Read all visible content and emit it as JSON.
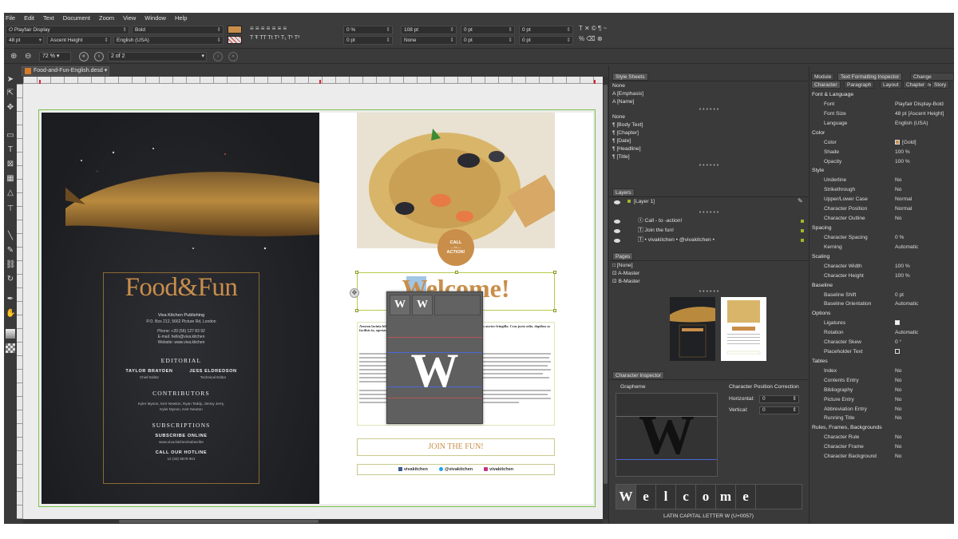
{
  "menu": [
    "File",
    "Edit",
    "Text",
    "Document",
    "Zoom",
    "View",
    "Window",
    "Help"
  ],
  "toolbar": {
    "font_family": "Playfair Display",
    "font_style": "Bold",
    "font_size": "48 pt",
    "ascent": "Ascent Height",
    "language": "English (USA)",
    "tracking": "0 %",
    "leading": "108 pt",
    "indent1": "0 pt",
    "indent2": "0 pt",
    "indent3": "0 pt",
    "indent4": "0 pt",
    "none": "None",
    "indent5": "0 pt",
    "indent6": "0 pt",
    "text_styles": "T Ŧ TT Tt T¹ T₁ T¹ T²",
    "align": "≡ ≡ ≡ ≡ ≡ ≡ ≡",
    "extra": "T ✕   © ¶ ~"
  },
  "nav": {
    "zoom": "72 %",
    "page": "2 of 2"
  },
  "document_tab": "Food-and-Fun-English.desd",
  "left_page": {
    "title": "Food&Fun",
    "publisher": "Viva Kitchen Publishing",
    "address": "P.O. Box 212, 5662 Picture Rd, London",
    "phone": "Phone: +20 (56) 127 83 92",
    "email": "E-mail: hello@viva.kitchen",
    "website": "Website: www.viva.kitchen",
    "editorial": "EDITORIAL",
    "editor1": "TAYLOR BRAYDEN",
    "editor1_role": "Chief Editor",
    "editor2": "JESS ELDREDSON",
    "editor2_role": "Technical Editor",
    "contributors": "CONTRIBUTORS",
    "contributors_list": "Kyler Mynon, Kerr Newton, Ryan Teddy, Jimmy Jerry,",
    "contributors_list2": "Kyler Mynon, Kerr Newton",
    "subscriptions": "SUBSCRIPTIONS",
    "subscribe_online": "SUBSCRIBE ONLINE",
    "subscribe_url": "www.viva.kitchen/subscribe",
    "hotline": "CALL OUR HOTLINE",
    "hotline_number": "12 (34) 5678 901"
  },
  "right_page": {
    "cta": "CALL",
    "cta2": "— to —",
    "cta3": "ACTION!",
    "welcome": "Welcome!",
    "body_heading": "Aenean lacinia bibendum nulla sed consectetur. Donec ullamcorper nulla non metus auctor fringilla. Cras justo odio, dapibus ac facilisis in, egestas eget quam.",
    "join": "JOIN THE FUN!",
    "social1": "vivakitchen",
    "social2": "@vivakitchen",
    "social3": "vivakitchen"
  },
  "glyph_popup": {
    "cell1": "W",
    "cell2": "W",
    "big": "W"
  },
  "style_sheets": {
    "title": "Style Sheets",
    "char_styles": [
      "None",
      "[Emphasis]",
      "[Name]"
    ],
    "para_styles": [
      "None",
      "[Body Text]",
      "[Chapter]",
      "[Date]",
      "[Headline]",
      "[Title]"
    ]
  },
  "layers": {
    "title": "Layers",
    "layer1": "[Layer 1]",
    "items": [
      "Call - to -action!",
      "Join the fun!",
      "• vivakitchen • @vivakitchen •"
    ]
  },
  "pages": {
    "title": "Pages",
    "items": [
      "[None]",
      "A-Master",
      "B-Master"
    ]
  },
  "char_inspector": {
    "title": "Character Inspector",
    "grapheme": "Grapheme",
    "big_glyph": "W",
    "pos_correction": "Character Position Correction",
    "horizontal": "Horizontal:",
    "horizontal_val": "0",
    "vertical": "Vertical:",
    "vertical_val": "0",
    "strip": [
      "W",
      "e",
      "l",
      "c",
      "o",
      "m",
      "e"
    ],
    "unicode": "LATIN CAPITAL LETTER W (U+0057)"
  },
  "inspector": {
    "tabs_top": [
      "Module",
      "Text Formatting Inspector",
      "Change Tracking"
    ],
    "tabs_bottom": [
      "Character",
      "Paragraph",
      "Layout",
      "Chapter",
      "Story"
    ],
    "sections": [
      {
        "title": "Font & Language",
        "rows": [
          [
            "Font",
            "Playfair Display-Bold"
          ],
          [
            "Font Size",
            "48 pt [Ascent Height]"
          ],
          [
            "Language",
            "English (USA)"
          ]
        ]
      },
      {
        "title": "Color",
        "rows": [
          [
            "Color",
            "[Gold]"
          ],
          [
            "Shade",
            "100 %"
          ],
          [
            "Opacity",
            "100 %"
          ]
        ]
      },
      {
        "title": "Style",
        "rows": [
          [
            "Underline",
            "No"
          ],
          [
            "Strikethrough",
            "No"
          ],
          [
            "Upper/Lower Case",
            "Normal"
          ],
          [
            "Character Position",
            "Normal"
          ],
          [
            "Character Outline",
            "No"
          ]
        ]
      },
      {
        "title": "Spacing",
        "rows": [
          [
            "Character Spacing",
            "0 %"
          ],
          [
            "Kerning",
            "Automatic"
          ]
        ]
      },
      {
        "title": "Scaling",
        "rows": [
          [
            "Character Width",
            "100 %"
          ],
          [
            "Character Height",
            "100 %"
          ]
        ]
      },
      {
        "title": "Baseline",
        "rows": [
          [
            "Baseline Shift",
            "0 pt"
          ],
          [
            "Baseline Orientation",
            "Automatic"
          ]
        ]
      },
      {
        "title": "Options",
        "rows": [
          [
            "Ligatures",
            ""
          ],
          [
            "Rotation",
            "Automatic"
          ],
          [
            "Character Skew",
            "0 °"
          ],
          [
            "Placeholder Text",
            ""
          ]
        ]
      },
      {
        "title": "Tables",
        "rows": [
          [
            "Index",
            "No"
          ],
          [
            "Contents Entry",
            "No"
          ],
          [
            "Bibliography",
            "No"
          ],
          [
            "Picture Entry",
            "No"
          ],
          [
            "Abbreviation Entry",
            "No"
          ],
          [
            "Running Title",
            "No"
          ]
        ]
      },
      {
        "title": "Rules, Frames, Backgrounds",
        "rows": [
          [
            "Character Rule",
            "No"
          ],
          [
            "Character Frame",
            "No"
          ],
          [
            "Character Background",
            "No"
          ]
        ]
      }
    ]
  },
  "colors": {
    "gold": "#c98e4a",
    "app_bg": "#3a3a3a",
    "frame_green": "#b7c94e"
  }
}
